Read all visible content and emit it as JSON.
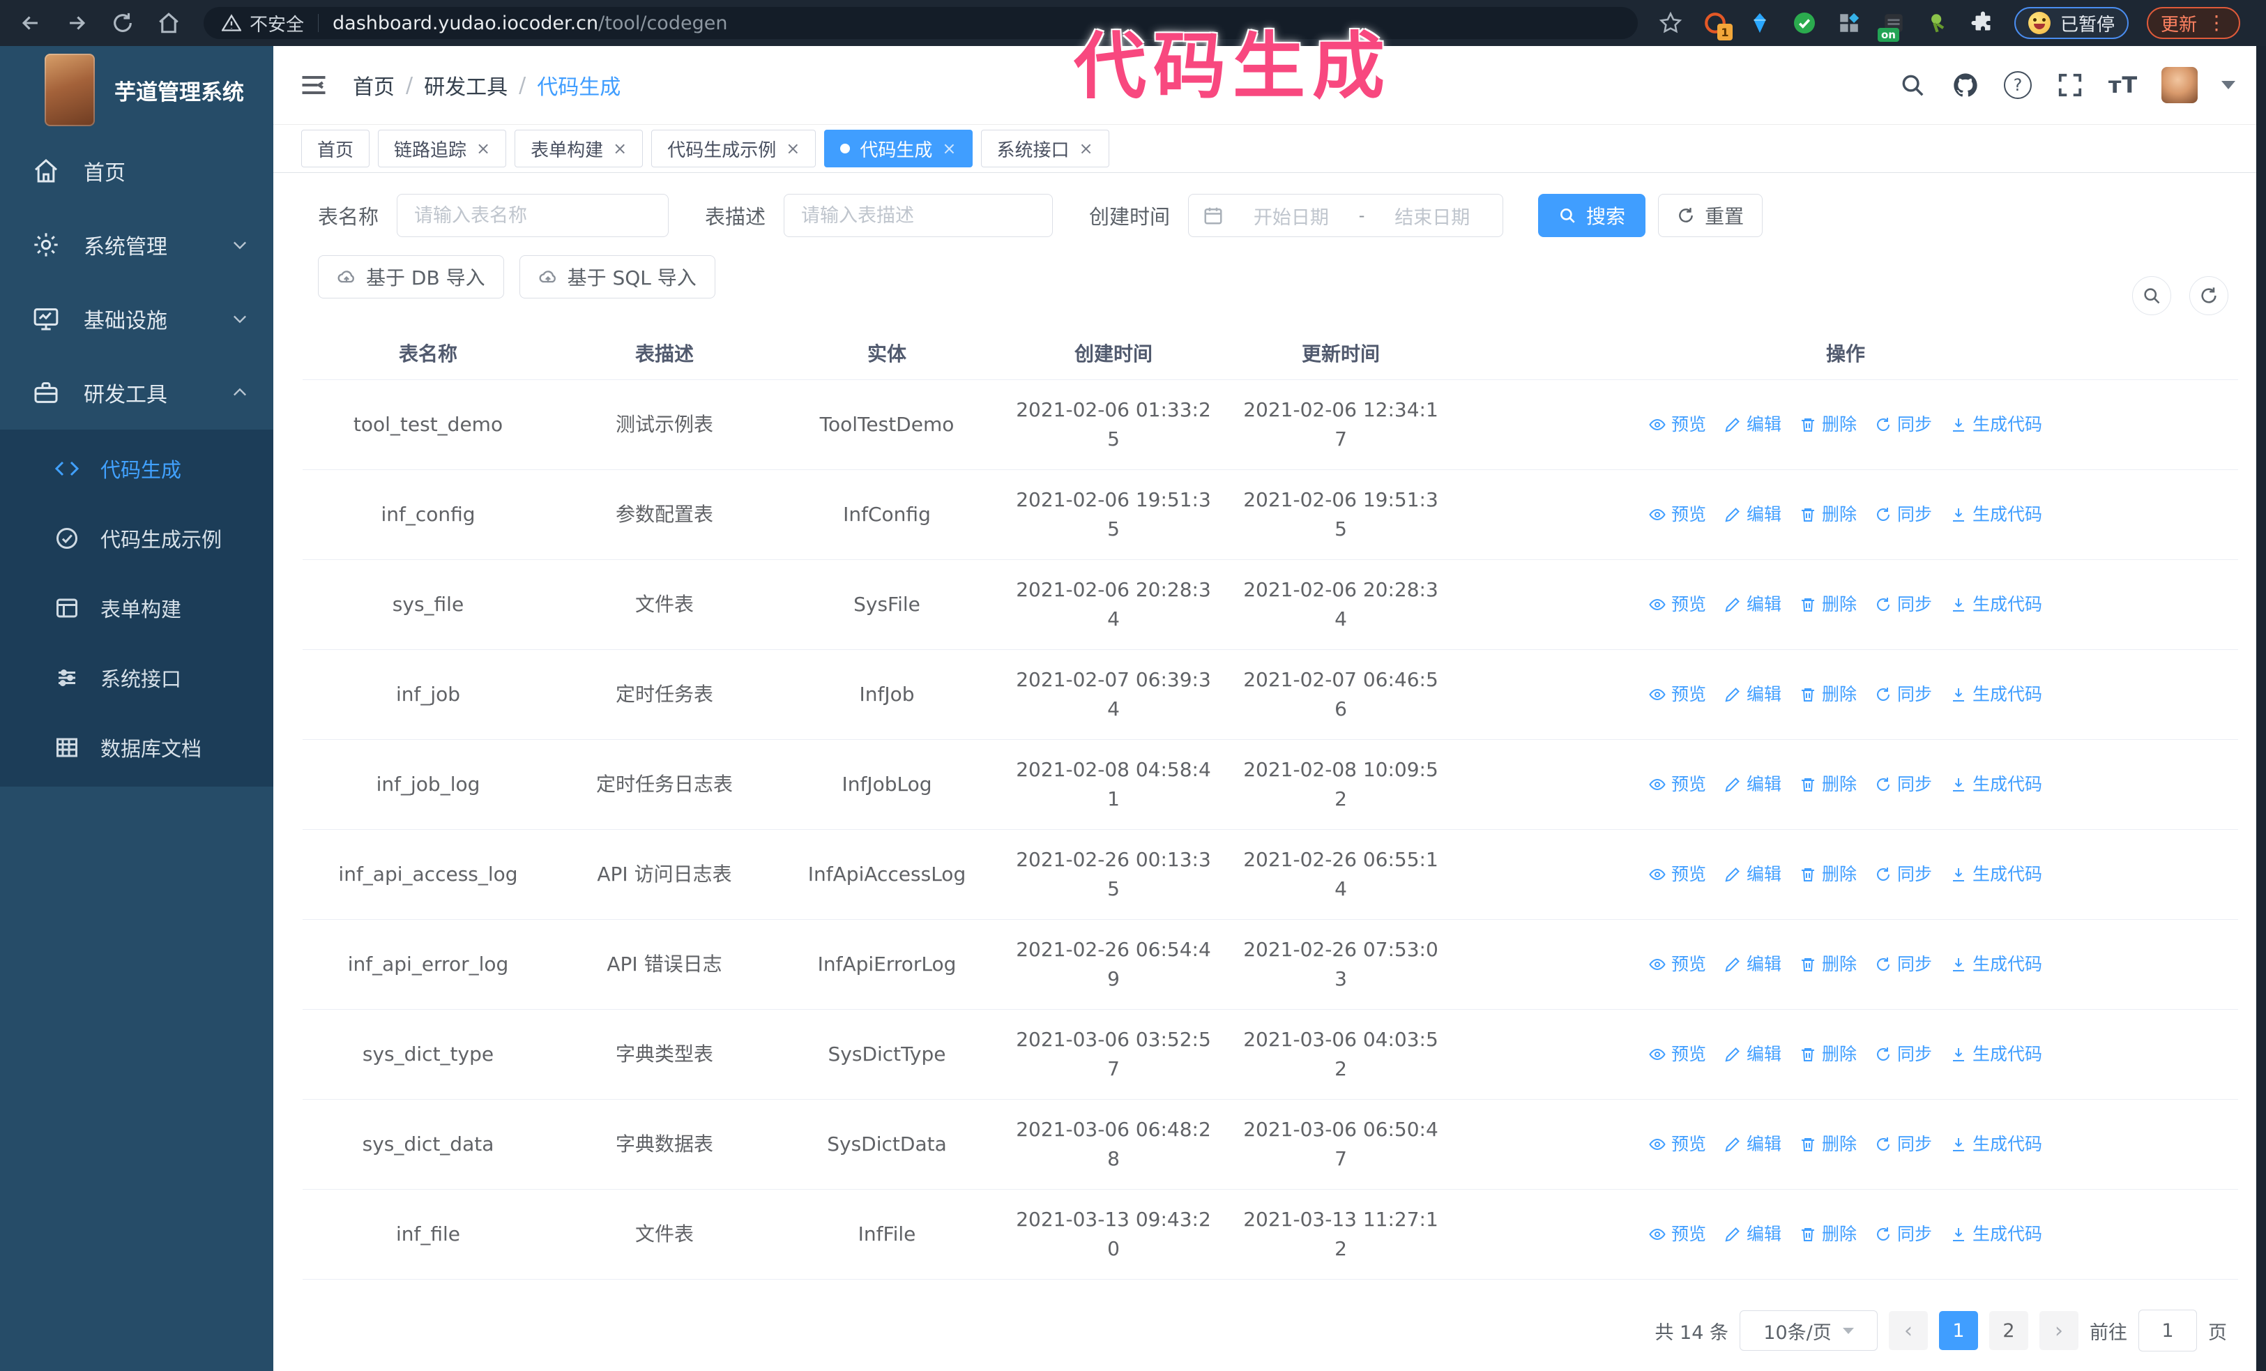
{
  "browser": {
    "security_label": "不安全",
    "url_host": "dashboard.yudao.iocoder.cn",
    "url_path": "/tool/codegen",
    "ext_badge_count": "1",
    "ext_badge_on": "on",
    "profile_label": "已暂停",
    "update_label": "更新"
  },
  "annotation": {
    "text": "代码生成",
    "color": "#f8487f"
  },
  "sidebar": {
    "app_title": "芋道管理系统",
    "menu": [
      {
        "label": "首页"
      },
      {
        "label": "系统管理"
      },
      {
        "label": "基础设施"
      },
      {
        "label": "研发工具"
      }
    ],
    "submenu": [
      {
        "label": "代码生成",
        "active": true
      },
      {
        "label": "代码生成示例"
      },
      {
        "label": "表单构建"
      },
      {
        "label": "系统接口"
      },
      {
        "label": "数据库文档"
      }
    ]
  },
  "header": {
    "breadcrumb": [
      "首页",
      "研发工具",
      "代码生成"
    ],
    "separator": "/"
  },
  "tabs": [
    {
      "label": "首页"
    },
    {
      "label": "链路追踪"
    },
    {
      "label": "表单构建"
    },
    {
      "label": "代码生成示例"
    },
    {
      "label": "代码生成"
    },
    {
      "label": "系统接口"
    }
  ],
  "filters": {
    "table_name_label": "表名称",
    "table_name_placeholder": "请输入表名称",
    "table_desc_label": "表描述",
    "table_desc_placeholder": "请输入表描述",
    "create_time_label": "创建时间",
    "date_start_placeholder": "开始日期",
    "date_separator": "-",
    "date_end_placeholder": "结束日期",
    "search_label": "搜索",
    "reset_label": "重置"
  },
  "toolbar": {
    "import_db_label": "基于 DB 导入",
    "import_sql_label": "基于 SQL 导入"
  },
  "table": {
    "columns": [
      "表名称",
      "表描述",
      "实体",
      "创建时间",
      "更新时间",
      "操作"
    ],
    "row_actions": [
      {
        "label": "预览"
      },
      {
        "label": "编辑"
      },
      {
        "label": "删除"
      },
      {
        "label": "同步"
      },
      {
        "label": "生成代码"
      }
    ],
    "rows": [
      {
        "name": "tool_test_demo",
        "desc": "测试示例表",
        "entity": "ToolTestDemo",
        "created": "2021-02-06 01:33:25",
        "updated": "2021-02-06 12:34:17"
      },
      {
        "name": "inf_config",
        "desc": "参数配置表",
        "entity": "InfConfig",
        "created": "2021-02-06 19:51:35",
        "updated": "2021-02-06 19:51:35"
      },
      {
        "name": "sys_file",
        "desc": "文件表",
        "entity": "SysFile",
        "created": "2021-02-06 20:28:34",
        "updated": "2021-02-06 20:28:34"
      },
      {
        "name": "inf_job",
        "desc": "定时任务表",
        "entity": "InfJob",
        "created": "2021-02-07 06:39:34",
        "updated": "2021-02-07 06:46:56"
      },
      {
        "name": "inf_job_log",
        "desc": "定时任务日志表",
        "entity": "InfJobLog",
        "created": "2021-02-08 04:58:41",
        "updated": "2021-02-08 10:09:52"
      },
      {
        "name": "inf_api_access_log",
        "desc": "API 访问日志表",
        "entity": "InfApiAccessLog",
        "created": "2021-02-26 00:13:35",
        "updated": "2021-02-26 06:55:14"
      },
      {
        "name": "inf_api_error_log",
        "desc": "API 错误日志",
        "entity": "InfApiErrorLog",
        "created": "2021-02-26 06:54:49",
        "updated": "2021-02-26 07:53:03"
      },
      {
        "name": "sys_dict_type",
        "desc": "字典类型表",
        "entity": "SysDictType",
        "created": "2021-03-06 03:52:57",
        "updated": "2021-03-06 04:03:52"
      },
      {
        "name": "sys_dict_data",
        "desc": "字典数据表",
        "entity": "SysDictData",
        "created": "2021-03-06 06:48:28",
        "updated": "2021-03-06 06:50:47"
      },
      {
        "name": "inf_file",
        "desc": "文件表",
        "entity": "InfFile",
        "created": "2021-03-13 09:43:20",
        "updated": "2021-03-13 11:27:12"
      }
    ]
  },
  "pagination": {
    "total_label": "共 14 条",
    "page_size": "10条/页",
    "pages": [
      "1",
      "2"
    ],
    "active_page": "1",
    "goto_label": "前往",
    "goto_value": "1",
    "page_unit": "页"
  },
  "colors": {
    "accent": "#409eff",
    "sidebar_bg": "#264c68",
    "submenu_bg": "#1c3d58",
    "chrome_bg": "#1d2733",
    "annotation_pink": "#f8487f",
    "table_border": "#ebeef5"
  }
}
